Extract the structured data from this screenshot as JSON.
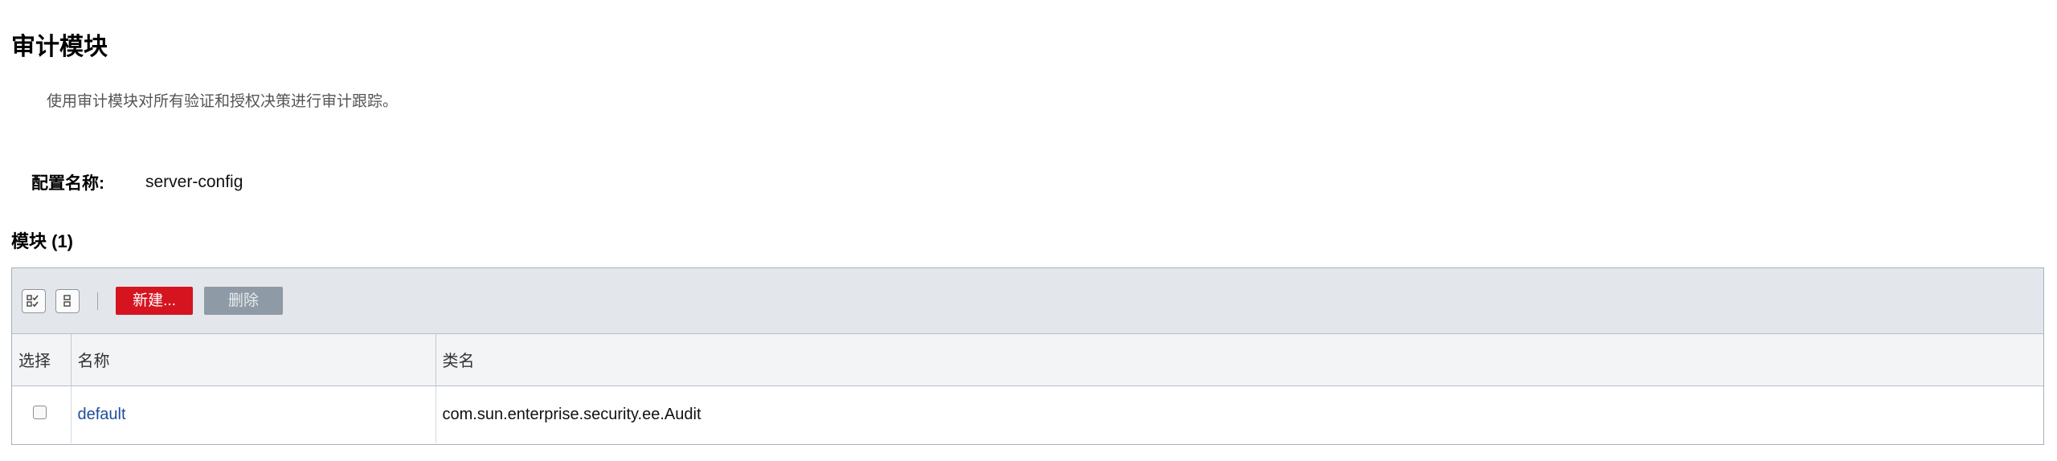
{
  "page": {
    "title": "审计模块",
    "description": "使用审计模块对所有验证和授权决策进行审计跟踪。"
  },
  "config": {
    "label": "配置名称:",
    "value": "server-config"
  },
  "section": {
    "title": "模块 (1)"
  },
  "toolbar": {
    "select_all_icon": "select-all-icon",
    "deselect_all_icon": "deselect-all-icon",
    "new_label": "新建...",
    "delete_label": "删除"
  },
  "table": {
    "headers": [
      "选择",
      "名称",
      "类名"
    ],
    "rows": [
      {
        "selected": false,
        "name": "default",
        "classname": "com.sun.enterprise.security.ee.Audit"
      }
    ]
  },
  "colors": {
    "new_button": "#d5141f",
    "delete_button": "#8e9ba6",
    "link": "#1f4e9c",
    "toolbar_bg": "#e3e7eb"
  }
}
